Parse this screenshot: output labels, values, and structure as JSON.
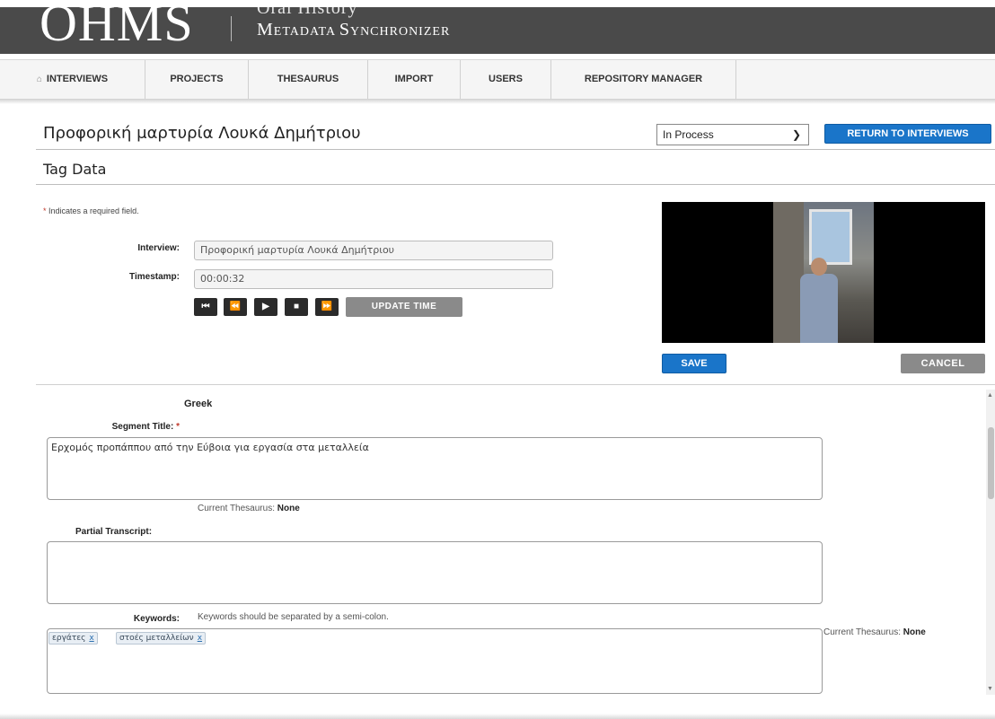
{
  "header": {
    "logo_main": "OHMS",
    "logo_sub_top": "Oral History",
    "logo_sub_m": "M",
    "logo_sub_etadata": "ETADATA ",
    "logo_sub_s": "S",
    "logo_sub_ynchronizer": "YNCHRONIZER"
  },
  "nav": {
    "interviews": "INTERVIEWS",
    "projects": "PROJECTS",
    "thesaurus": "THESAURUS",
    "import": "IMPORT",
    "users": "USERS",
    "repository_manager": "REPOSITORY MANAGER"
  },
  "page": {
    "title": "Προφορική μαρτυρία Λουκά Δημήτριου",
    "status": "In Process",
    "return_button": "RETURN TO INTERVIEWS",
    "section_title": "Tag Data",
    "required_note_star": "*",
    "required_note": " Indicates a required field."
  },
  "form": {
    "interview_label": "Interview:",
    "interview_value": "Προφορική μαρτυρία Λουκά Δημήτριου",
    "timestamp_label": "Timestamp:",
    "timestamp_value": "00:00:32",
    "update_time": "UPDATE TIME",
    "controls": [
      "⏮",
      "⏪",
      "▶",
      "■",
      "⏩"
    ]
  },
  "actions": {
    "save": "SAVE",
    "cancel": "CANCEL"
  },
  "segment": {
    "language": "Greek",
    "title_label": "Segment Title:",
    "title_star": "*",
    "title_value": "Ερχομός προπάππου από την Εύβοια για εργασία στα μεταλλεία",
    "thesaurus_label": "Current Thesaurus: ",
    "thesaurus_value": "None",
    "transcript_label": "Partial Transcript:",
    "transcript_value": "",
    "keywords_label": "Keywords:",
    "keywords_hint": "Keywords should be separated by a semi-colon.",
    "keywords": [
      "εργάτες",
      "στοές μεταλλείων"
    ],
    "keyword_remove": "x",
    "keywords_thesaurus_label": "Current Thesaurus: ",
    "keywords_thesaurus_value": "None"
  },
  "colors": {
    "header_bg": "#4a4a4a",
    "accent_blue": "#1a75c9",
    "gray_button": "#8a8a8a"
  }
}
